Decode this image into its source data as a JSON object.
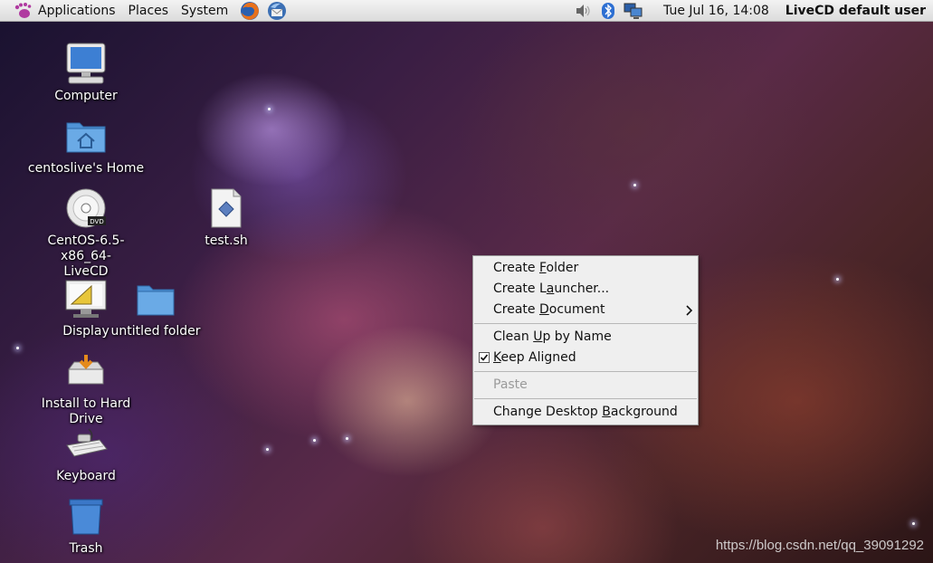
{
  "panel": {
    "menus": [
      "Applications",
      "Places",
      "System"
    ],
    "launchers": [
      "firefox-icon",
      "thunderbird-icon"
    ],
    "tray": [
      "volume-icon",
      "bluetooth-icon",
      "network-icon"
    ],
    "clock": "Tue Jul 16, 14:08",
    "user": "LiveCD default user"
  },
  "desktop": {
    "icons": [
      {
        "name": "computer-icon",
        "label": "Computer"
      },
      {
        "name": "home-folder-icon",
        "label": "centoslive's Home"
      },
      {
        "name": "dvd-icon",
        "label_line1": "CentOS-6.5-x86_64-",
        "label_line2": "LiveCD"
      },
      {
        "name": "display-icon",
        "label": "Display"
      },
      {
        "name": "folder-icon",
        "label": "untitled folder"
      },
      {
        "name": "script-file-icon",
        "label": "test.sh"
      },
      {
        "name": "install-drive-icon",
        "label": "Install to Hard Drive"
      },
      {
        "name": "keyboard-icon",
        "label": "Keyboard"
      },
      {
        "name": "trash-icon",
        "label": "Trash"
      }
    ]
  },
  "context_menu": {
    "create_folder": {
      "pre": "Create ",
      "mnemonic": "F",
      "post": "older"
    },
    "create_launcher": {
      "pre": "Create L",
      "mnemonic": "a",
      "post": "uncher..."
    },
    "create_document": {
      "pre": "Create ",
      "mnemonic": "D",
      "post": "ocument"
    },
    "clean_up": {
      "pre": "Clean ",
      "mnemonic": "U",
      "post": "p by Name"
    },
    "keep_aligned": {
      "pre": "",
      "mnemonic": "K",
      "post": "eep Aligned",
      "checked": true
    },
    "paste": {
      "label": "Paste",
      "disabled": true
    },
    "change_background": {
      "pre": "Change Desktop ",
      "mnemonic": "B",
      "post": "ackground"
    }
  },
  "watermark": "https://blog.csdn.net/qq_39091292",
  "colors": {
    "panel": "#e6e6e6",
    "menu_bg": "#efefef",
    "folder_blue": "#5a9fd8"
  }
}
